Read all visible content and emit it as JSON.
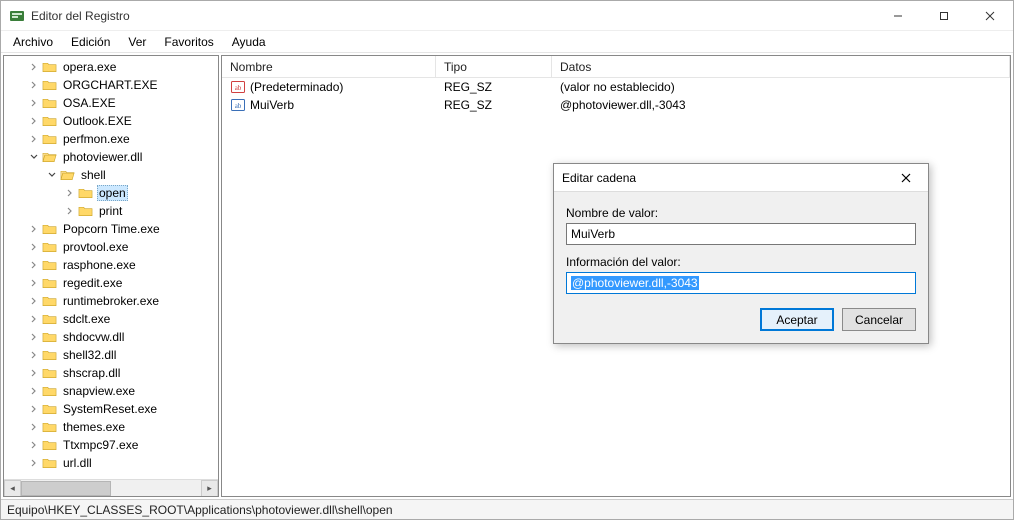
{
  "window": {
    "title": "Editor del Registro"
  },
  "menu": {
    "file": "Archivo",
    "edit": "Edición",
    "view": "Ver",
    "favorites": "Favoritos",
    "help": "Ayuda"
  },
  "tree": [
    {
      "depth": 1,
      "exp": "closed",
      "label": "opera.exe"
    },
    {
      "depth": 1,
      "exp": "closed",
      "label": "ORGCHART.EXE"
    },
    {
      "depth": 1,
      "exp": "closed",
      "label": "OSA.EXE"
    },
    {
      "depth": 1,
      "exp": "closed",
      "label": "Outlook.EXE"
    },
    {
      "depth": 1,
      "exp": "closed",
      "label": "perfmon.exe"
    },
    {
      "depth": 1,
      "exp": "open",
      "label": "photoviewer.dll",
      "open": true
    },
    {
      "depth": 2,
      "exp": "open",
      "label": "shell",
      "open": true
    },
    {
      "depth": 3,
      "exp": "closed",
      "label": "open",
      "selected": true
    },
    {
      "depth": 3,
      "exp": "closed",
      "label": "print"
    },
    {
      "depth": 1,
      "exp": "closed",
      "label": "Popcorn Time.exe"
    },
    {
      "depth": 1,
      "exp": "closed",
      "label": "provtool.exe"
    },
    {
      "depth": 1,
      "exp": "closed",
      "label": "rasphone.exe"
    },
    {
      "depth": 1,
      "exp": "closed",
      "label": "regedit.exe"
    },
    {
      "depth": 1,
      "exp": "closed",
      "label": "runtimebroker.exe"
    },
    {
      "depth": 1,
      "exp": "closed",
      "label": "sdclt.exe"
    },
    {
      "depth": 1,
      "exp": "closed",
      "label": "shdocvw.dll"
    },
    {
      "depth": 1,
      "exp": "closed",
      "label": "shell32.dll"
    },
    {
      "depth": 1,
      "exp": "closed",
      "label": "shscrap.dll"
    },
    {
      "depth": 1,
      "exp": "closed",
      "label": "snapview.exe"
    },
    {
      "depth": 1,
      "exp": "closed",
      "label": "SystemReset.exe"
    },
    {
      "depth": 1,
      "exp": "closed",
      "label": "themes.exe"
    },
    {
      "depth": 1,
      "exp": "closed",
      "label": "Ttxmpc97.exe"
    },
    {
      "depth": 1,
      "exp": "closed",
      "label": "url.dll"
    }
  ],
  "list": {
    "columns": {
      "name": "Nombre",
      "type": "Tipo",
      "data": "Datos"
    },
    "rows": [
      {
        "name": "(Predeterminado)",
        "type": "REG_SZ",
        "data": "(valor no establecido)",
        "iconColor": "#d04040"
      },
      {
        "name": "MuiVerb",
        "type": "REG_SZ",
        "data": "@photoviewer.dll,-3043",
        "iconColor": "#3a6fb7"
      }
    ]
  },
  "dialog": {
    "title": "Editar cadena",
    "nameLabel": "Nombre de valor:",
    "nameValue": "MuiVerb",
    "dataLabel": "Información del valor:",
    "dataValue": "@photoviewer.dll,-3043",
    "ok": "Aceptar",
    "cancel": "Cancelar"
  },
  "statusbar": "Equipo\\HKEY_CLASSES_ROOT\\Applications\\photoviewer.dll\\shell\\open"
}
